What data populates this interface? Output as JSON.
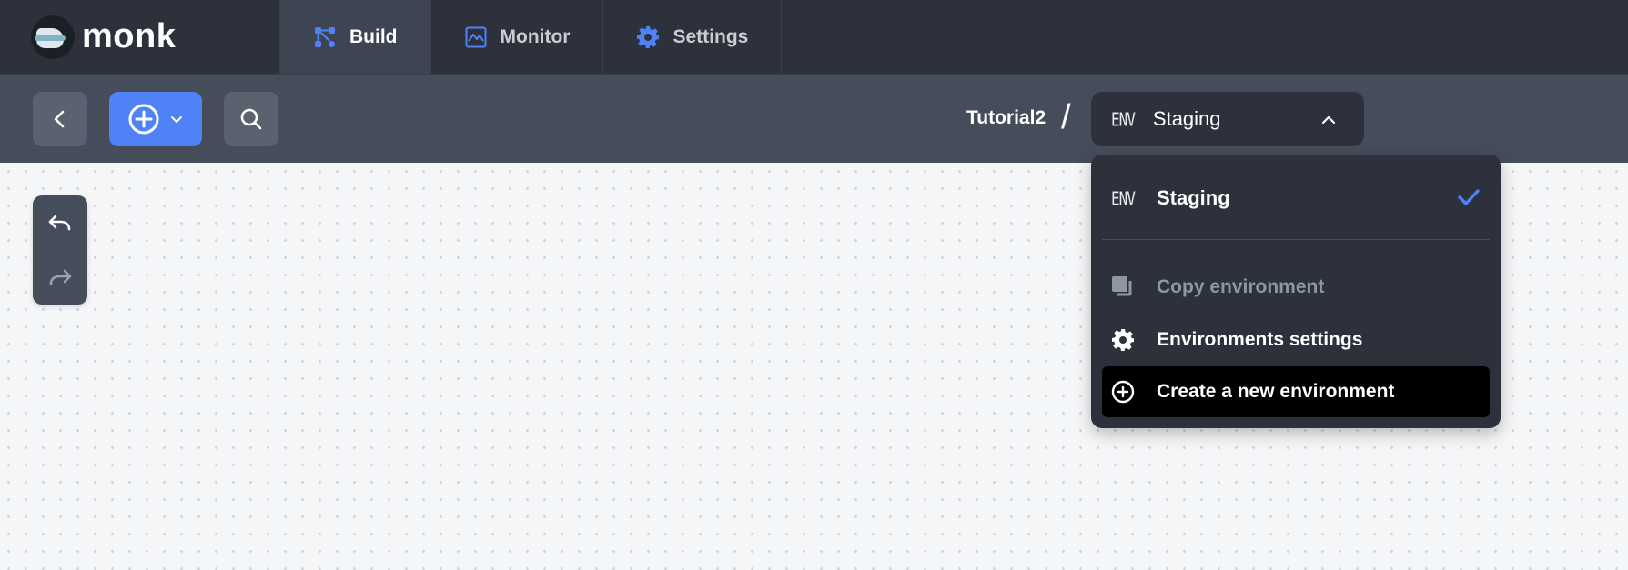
{
  "app": {
    "name": "monk"
  },
  "nav": {
    "tabs": [
      {
        "label": "Build",
        "icon": "build-icon",
        "active": true
      },
      {
        "label": "Monitor",
        "icon": "monitor-chart-icon",
        "active": false
      },
      {
        "label": "Settings",
        "icon": "gear-icon",
        "active": false
      }
    ]
  },
  "toolbar": {
    "project": "Tutorial2",
    "separator": "/",
    "env_tag": "ENV",
    "env_selected": "Staging"
  },
  "dropdown": {
    "current": {
      "tag": "ENV",
      "label": "Staging"
    },
    "actions": [
      {
        "label": "Copy environment",
        "icon": "copy-icon",
        "disabled": true
      },
      {
        "label": "Environments settings",
        "icon": "gear-icon",
        "disabled": false
      },
      {
        "label": "Create a new environment",
        "icon": "plus-circle-icon",
        "disabled": false
      }
    ]
  },
  "colors": {
    "topbar": "#2c313b",
    "toolbar": "#454d5b",
    "accent": "#4f82f7",
    "check": "#4f82f7"
  }
}
